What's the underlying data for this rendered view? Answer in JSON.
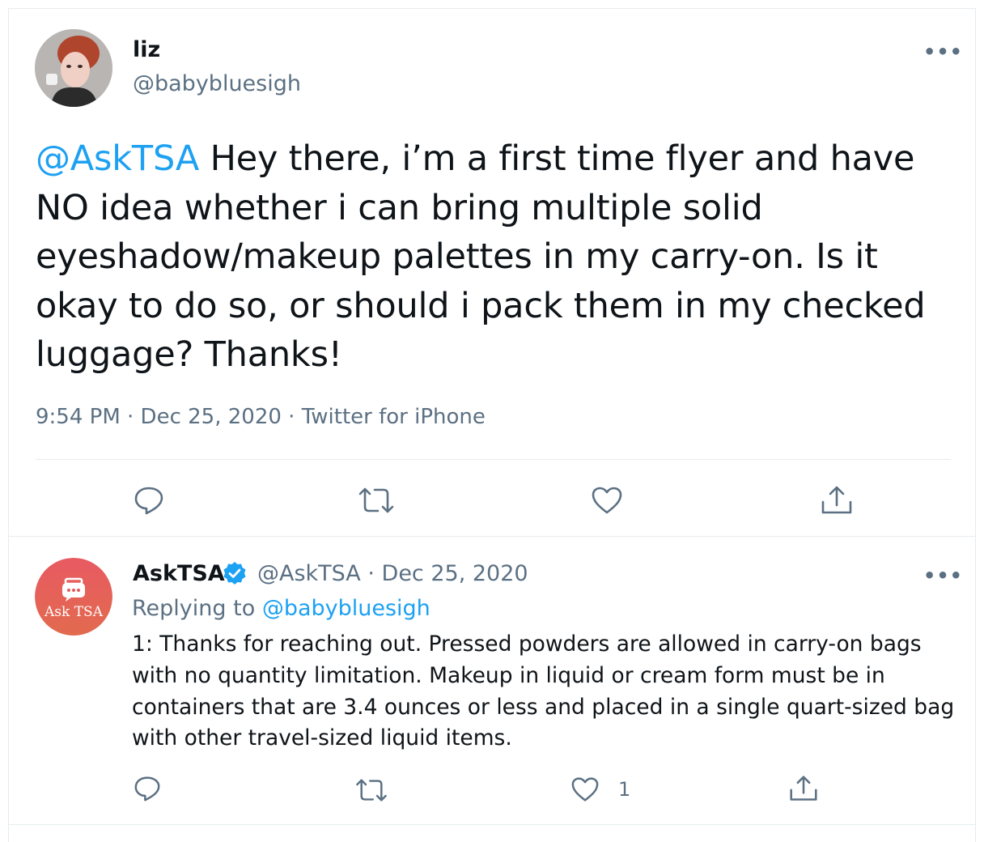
{
  "tweet": {
    "display_name": "liz",
    "handle": "@babybluesigh",
    "mention": "@AskTSA",
    "body": " Hey there, i’m a first time flyer and have NO idea whether i can bring multiple solid eyeshadow/makeup palettes in my carry-on. Is it okay to do so, or should i pack them in my checked luggage? Thanks!",
    "timestamp": "9:54 PM · Dec 25, 2020 · Twitter for iPhone",
    "more_label": "•••"
  },
  "reply": {
    "display_name": "AskTSA",
    "handle_date": "@AskTSA · Dec 25, 2020",
    "replying_prefix": "Replying to ",
    "replying_to": "@babybluesigh",
    "body": "1: Thanks for reaching out. Pressed powders are allowed in carry-on bags with no quantity limitation. Makeup in liquid or cream form must be in containers that are 3.4 ounces or less and placed in a single quart-sized bag with other travel-sized liquid items.",
    "like_count": "1",
    "avatar_text": "Ask TSA",
    "more_label": "•••"
  },
  "icons": {
    "reply": "reply-icon",
    "retweet": "retweet-icon",
    "like": "heart-icon",
    "share": "share-icon",
    "verified": "verified-badge-icon"
  },
  "colors": {
    "link": "#1da1f2",
    "secondary_text": "#5b7083",
    "divider": "#e6ecf0",
    "tsa_avatar": "#e0595a"
  }
}
